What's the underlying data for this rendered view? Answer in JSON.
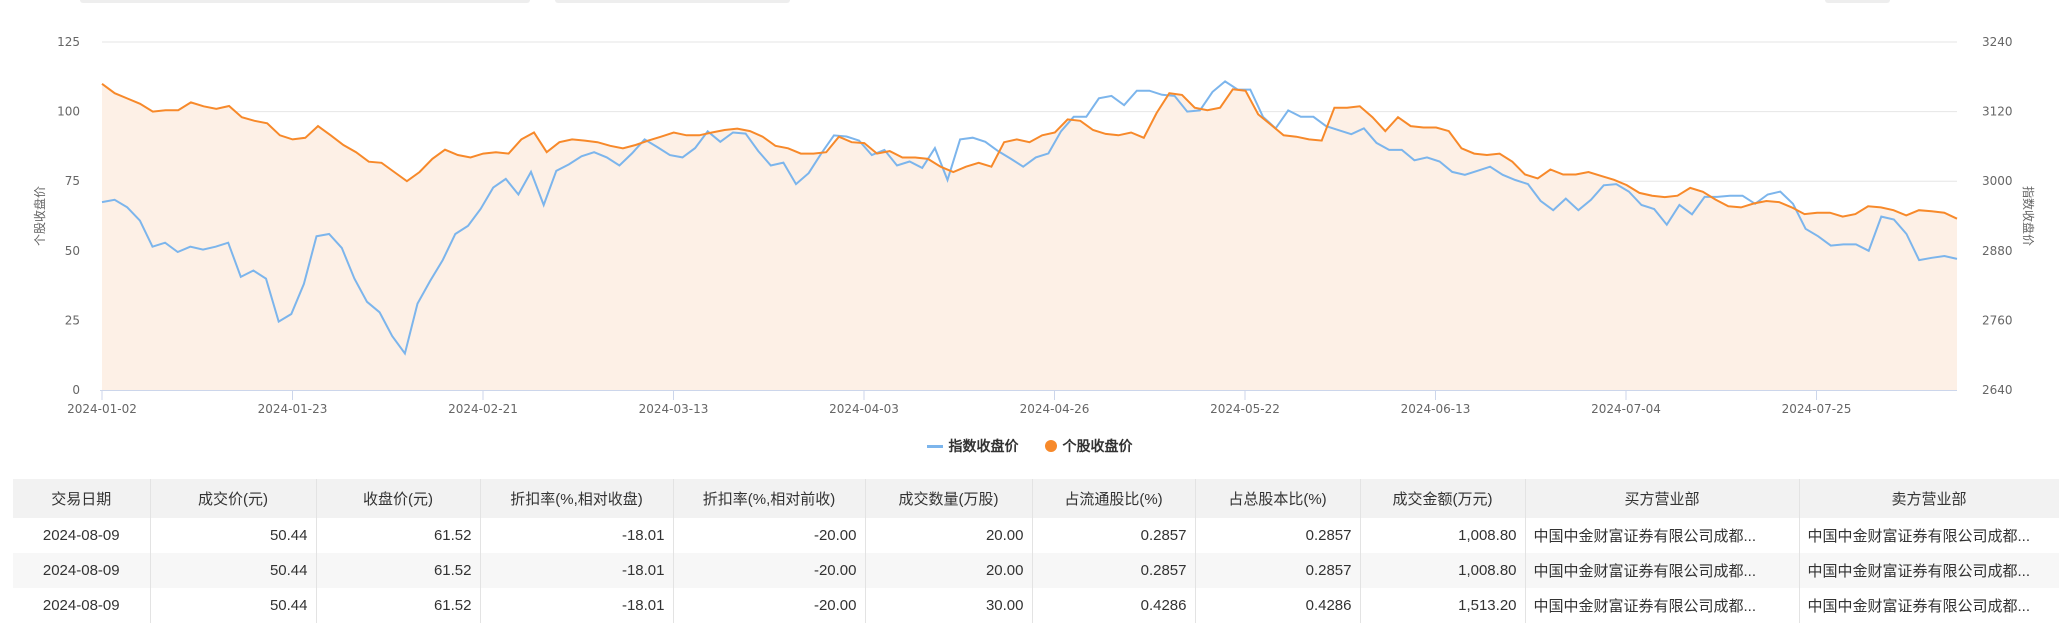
{
  "chart_data": {
    "type": "line",
    "title": "",
    "x_tick_labels": [
      "2024-01-02",
      "2024-01-23",
      "2024-02-21",
      "2024-03-13",
      "2024-04-03",
      "2024-04-26",
      "2024-05-22",
      "2024-06-13",
      "2024-07-04",
      "2024-07-25"
    ],
    "left_axis": {
      "label": "个股收盘价",
      "range": [
        0,
        125
      ],
      "ticks": [
        "0",
        "25",
        "50",
        "75",
        "100",
        "125"
      ]
    },
    "right_axis": {
      "label": "指数收盘价",
      "range": [
        2640,
        3240
      ],
      "ticks": [
        "2640",
        "2760",
        "2880",
        "3000",
        "3120",
        "3240"
      ]
    },
    "grid": true,
    "legend_position": "bottom-center",
    "series": [
      {
        "name": "指数收盘价",
        "axis": "right",
        "color": "#7cb5ec",
        "values": [
          2964,
          2968,
          2955,
          2932,
          2887,
          2894,
          2878,
          2887,
          2882,
          2887,
          2894,
          2835,
          2846,
          2832,
          2758,
          2771,
          2823,
          2905,
          2909,
          2885,
          2832,
          2792,
          2774,
          2733,
          2703,
          2789,
          2828,
          2864,
          2909,
          2923,
          2952,
          2989,
          3004,
          2977,
          3016,
          2959,
          3018,
          3029,
          3043,
          3050,
          3041,
          3027,
          3048,
          3072,
          3059,
          3045,
          3041,
          3057,
          3086,
          3068,
          3084,
          3082,
          3052,
          3027,
          3032,
          2995,
          3014,
          3048,
          3079,
          3077,
          3070,
          3045,
          3054,
          3027,
          3034,
          3023,
          3057,
          3002,
          3072,
          3075,
          3068,
          3052,
          3039,
          3025,
          3041,
          3048,
          3086,
          3111,
          3111,
          3143,
          3147,
          3131,
          3156,
          3156,
          3149,
          3147,
          3120,
          3122,
          3154,
          3172,
          3158,
          3158,
          3111,
          3091,
          3122,
          3111,
          3111,
          3095,
          3088,
          3081,
          3091,
          3066,
          3054,
          3054,
          3036,
          3041,
          3034,
          3016,
          3011,
          3018,
          3025,
          3011,
          3002,
          2995,
          2966,
          2950,
          2970,
          2950,
          2968,
          2993,
          2995,
          2982,
          2959,
          2952,
          2925,
          2959,
          2943,
          2973,
          2973,
          2975,
          2975,
          2961,
          2977,
          2982,
          2961,
          2918,
          2905,
          2889,
          2891,
          2891,
          2880,
          2939,
          2934,
          2909,
          2864,
          2868,
          2871,
          2866
        ]
      },
      {
        "name": "个股收盘价",
        "axis": "left",
        "color": "#f7892a",
        "values": [
          110,
          106.6,
          104.7,
          102.8,
          100,
          100.5,
          100.5,
          103.3,
          101.9,
          101,
          102,
          98,
          96.7,
          95.8,
          91.5,
          90,
          90.6,
          94.8,
          91.5,
          88,
          85.4,
          82,
          81.6,
          78.3,
          75,
          78.3,
          83,
          86.3,
          84.4,
          83.5,
          84.9,
          85.4,
          84.9,
          90,
          92.5,
          85.4,
          89,
          90,
          89.6,
          89,
          87.7,
          86.8,
          88,
          89.6,
          91,
          92.5,
          91.5,
          91.5,
          92.5,
          93.4,
          93.9,
          93,
          91,
          87.7,
          86.8,
          84.9,
          84.9,
          85.4,
          91,
          89,
          88.7,
          84.9,
          85.8,
          83.5,
          83.5,
          83,
          80.2,
          78.3,
          80.2,
          81.6,
          80.2,
          89,
          90,
          89,
          91.5,
          92.5,
          97.2,
          96.7,
          93.4,
          92,
          91.5,
          92.5,
          90.6,
          99.5,
          106.6,
          106,
          101.4,
          100.5,
          101.4,
          108,
          107.5,
          99,
          95.3,
          91.5,
          91,
          90,
          89.6,
          101.4,
          101.4,
          101.9,
          98,
          93,
          98,
          94.8,
          94.3,
          94.3,
          93,
          86.8,
          84.9,
          84.4,
          84.9,
          82,
          77.4,
          76,
          79.2,
          77.4,
          77.4,
          78.3,
          76.9,
          75.5,
          73.6,
          70.8,
          69.8,
          69.3,
          69.8,
          72.6,
          71.2,
          68.4,
          66,
          65.6,
          67,
          67.9,
          67.5,
          65.6,
          63.2,
          63.7,
          63.7,
          62.3,
          63.2,
          66,
          65.6,
          64.6,
          62.7,
          64.6,
          64.2,
          63.7,
          61.52
        ]
      }
    ]
  },
  "legend": {
    "index_label": "指数收盘价",
    "stock_label": "个股收盘价"
  },
  "table": {
    "headers": [
      "交易日期",
      "成交价(元)",
      "收盘价(元)",
      "折扣率(%,相对收盘)",
      "折扣率(%,相对前收)",
      "成交数量(万股)",
      "占流通股比(%)",
      "占总股本比(%)",
      "成交金额(万元)",
      "买方营业部",
      "卖方营业部"
    ],
    "rows": [
      [
        "2024-08-09",
        "50.44",
        "61.52",
        "-18.01",
        "-20.00",
        "20.00",
        "0.2857",
        "0.2857",
        "1,008.80",
        "中国中金财富证券有限公司成都...",
        "中国中金财富证券有限公司成都..."
      ],
      [
        "2024-08-09",
        "50.44",
        "61.52",
        "-18.01",
        "-20.00",
        "20.00",
        "0.2857",
        "0.2857",
        "1,008.80",
        "中国中金财富证券有限公司成都...",
        "中国中金财富证券有限公司成都..."
      ],
      [
        "2024-08-09",
        "50.44",
        "61.52",
        "-18.01",
        "-20.00",
        "30.00",
        "0.4286",
        "0.4286",
        "1,513.20",
        "中国中金财富证券有限公司成都...",
        "中国中金财富证券有限公司成都..."
      ]
    ]
  }
}
